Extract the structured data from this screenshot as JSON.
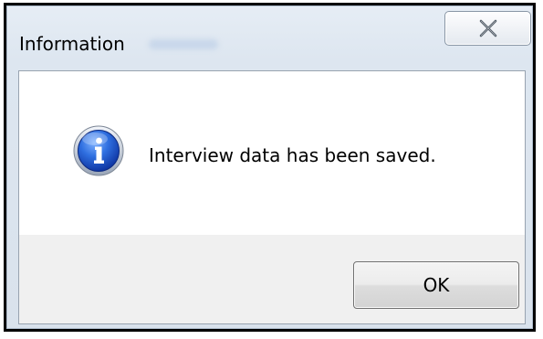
{
  "dialog": {
    "title": "Information",
    "message": "Interview data has been saved.",
    "icon": "information-icon",
    "close_icon": "close-icon",
    "ok_label": "OK"
  }
}
